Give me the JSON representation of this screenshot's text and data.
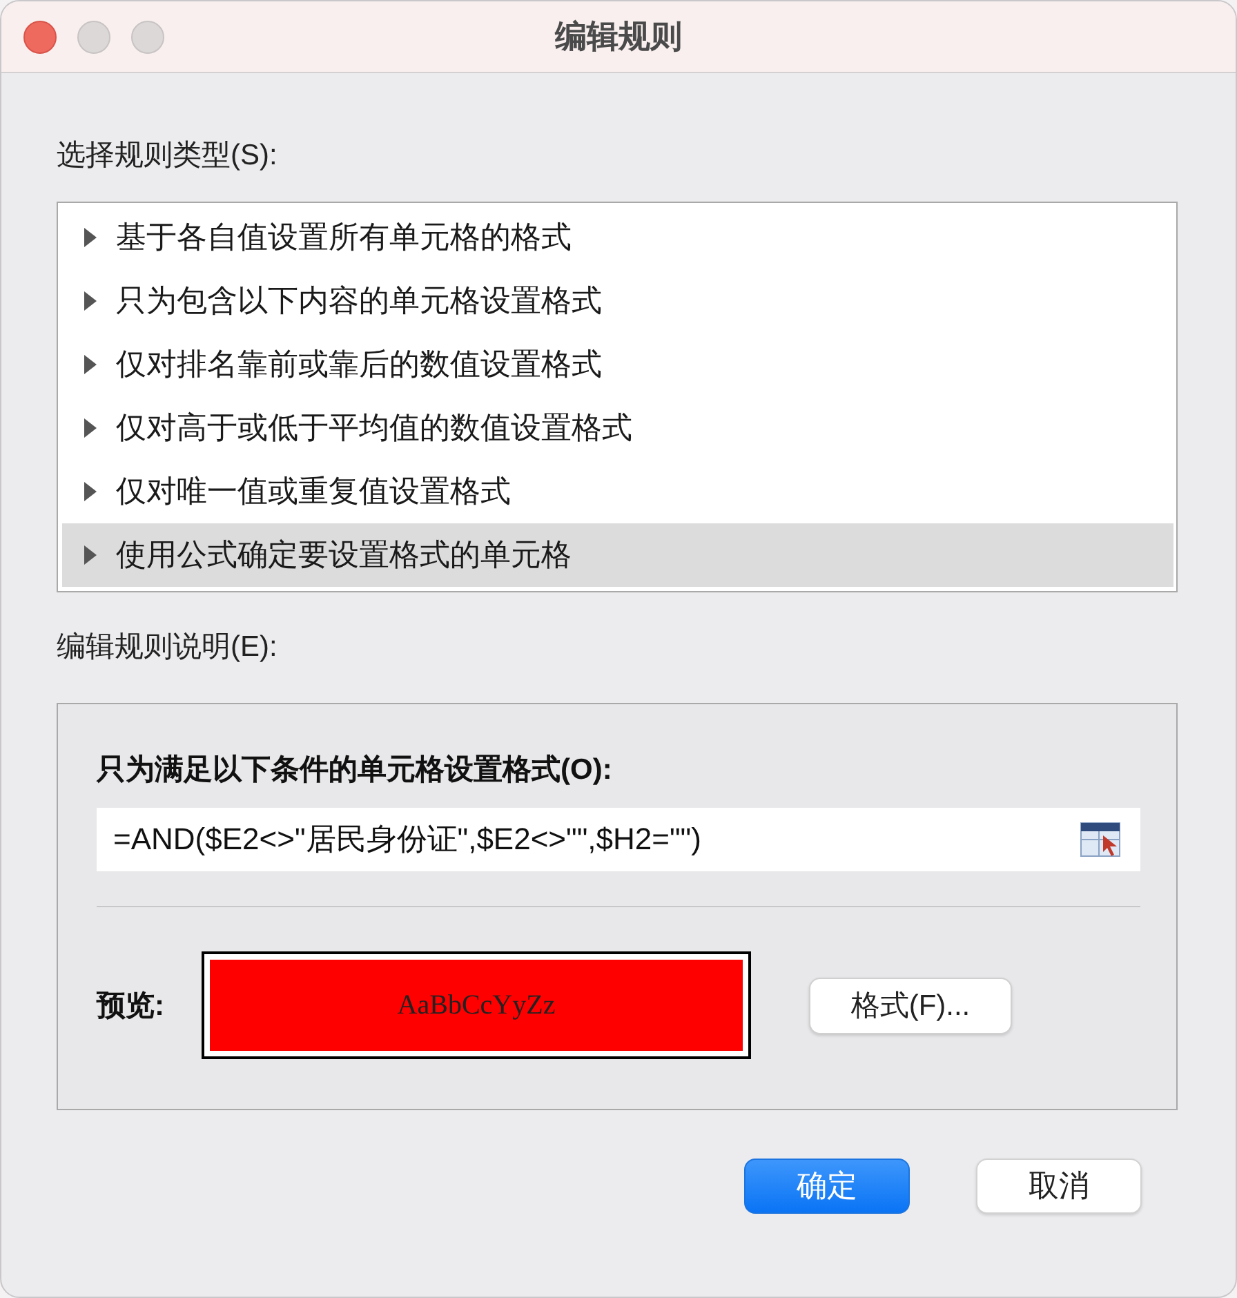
{
  "window": {
    "title": "编辑规则"
  },
  "rule_type": {
    "label": "选择规则类型(S):",
    "items": [
      {
        "label": "基于各自值设置所有单元格的格式",
        "selected": false
      },
      {
        "label": "只为包含以下内容的单元格设置格式",
        "selected": false
      },
      {
        "label": "仅对排名靠前或靠后的数值设置格式",
        "selected": false
      },
      {
        "label": "仅对高于或低于平均值的数值设置格式",
        "selected": false
      },
      {
        "label": "仅对唯一值或重复值设置格式",
        "selected": false
      },
      {
        "label": "使用公式确定要设置格式的单元格",
        "selected": true
      }
    ]
  },
  "description": {
    "label": "编辑规则说明(E):",
    "condition_label": "只为满足以下条件的单元格设置格式(O):",
    "formula": "=AND($E2<>\"居民身份证\",$E2<>\"\",$H2=\"\")",
    "preview_label": "预览:",
    "preview_sample": "AaBbCcYyZz",
    "format_button": "格式(F)..."
  },
  "buttons": [
    {
      "label": "确定",
      "kind": "primary"
    },
    {
      "label": "取消",
      "kind": "secondary"
    }
  ]
}
